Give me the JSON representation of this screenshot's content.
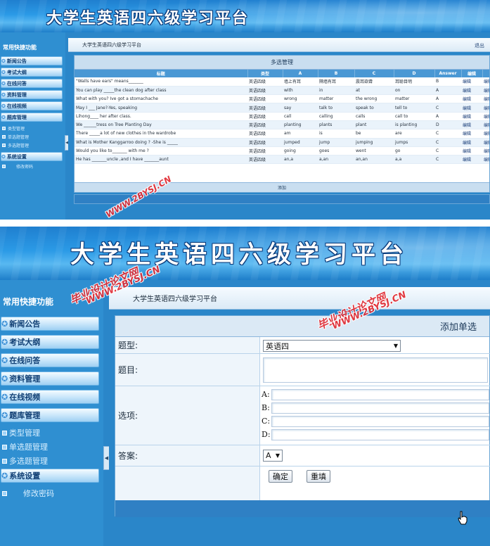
{
  "app": {
    "banner_title": "大学生英语四六级学习平台",
    "breadcrumb": "大学生英语四六级学习平台",
    "exit_label": "退出"
  },
  "sidebar": {
    "quick_title": "常用快捷功能",
    "menu": [
      {
        "label": "新闻公告",
        "icon": "star-icon"
      },
      {
        "label": "考试大纲",
        "icon": "star-icon"
      },
      {
        "label": "在线问答",
        "icon": "star-icon"
      },
      {
        "label": "资料管理",
        "icon": "star-icon"
      },
      {
        "label": "在线视频",
        "icon": "star-icon"
      },
      {
        "label": "题库管理",
        "icon": "star-icon"
      }
    ],
    "sub_items": [
      "类型管理",
      "单选题管理",
      "多选题管理"
    ],
    "system": {
      "label": "系统设置",
      "sub": "修改密码"
    }
  },
  "list_view": {
    "panel_title": "多选管理",
    "columns": [
      "标题",
      "类型",
      "A",
      "B",
      "C",
      "D",
      "Answer",
      "编辑"
    ],
    "edit_label": "编辑",
    "rows": [
      {
        "title": "\"Walls have ears\" means_______",
        "type": "英语四级",
        "a": "墙上有耳",
        "b": "隔墙有耳",
        "c": "震耳欲聋",
        "d": "耳聪目明",
        "answer": "B"
      },
      {
        "title": "You can play _____the clean dog after class",
        "type": "英语四级",
        "a": "with",
        "b": "in",
        "c": "at",
        "d": "on",
        "answer": "A"
      },
      {
        "title": "What with you? Ive got a stomachache",
        "type": "英语四级",
        "a": "wrong",
        "b": "matter",
        "c": "the wrong",
        "d": "matter",
        "answer": "A"
      },
      {
        "title": "May I ___ Jane?-Yes, speaking",
        "type": "英语四级",
        "a": "say",
        "b": "talk to",
        "c": "speak to",
        "d": "tell to",
        "answer": "C"
      },
      {
        "title": "Lihong____ her after class.",
        "type": "英语四级",
        "a": "call",
        "b": "calling",
        "c": "calls",
        "d": "call to",
        "answer": "A"
      },
      {
        "title": "We ______tress on Tree Planting Day",
        "type": "英语四级",
        "a": "planting",
        "b": "plants",
        "c": "plant",
        "d": "is planting",
        "answer": "D"
      },
      {
        "title": "There _____a lot of new clothes in the wardrobe",
        "type": "英语四级",
        "a": "am",
        "b": "is",
        "c": "be",
        "d": "are",
        "answer": "C"
      },
      {
        "title": "What is Mother Kanggarroo doing ? -She is _____",
        "type": "英语四级",
        "a": "jumped",
        "b": "jump",
        "c": "jumping",
        "d": "jumps",
        "answer": "C"
      },
      {
        "title": "Would you like to_______ with me ?",
        "type": "英语四级",
        "a": "going",
        "b": "goes",
        "c": "went",
        "d": "go",
        "answer": "C"
      },
      {
        "title": "He has _______uncle ,and I have _______aunt",
        "type": "英语四级",
        "a": "an,a",
        "b": "a,an",
        "c": "an,an",
        "d": "a,a",
        "answer": "C"
      }
    ],
    "add_label": "添加"
  },
  "form_view": {
    "form_title": "添加单选",
    "type_label": "题型:",
    "type_value": "英语四",
    "question_label": "题目:",
    "options_label": "选项:",
    "option_letters": [
      "A:",
      "B:",
      "C:",
      "D:"
    ],
    "answer_label": "答案:",
    "answer_value": "A",
    "confirm_label": "确定",
    "reset_label": "重填"
  },
  "watermarks": [
    "毕业设计论文网",
    "WWW.2BYSJ.CN"
  ],
  "colors": {
    "banner": "#2b9ae6",
    "sidebar": "#2f8fd1",
    "content_bg": "#2a86c9",
    "watermark": "#e0262e"
  }
}
